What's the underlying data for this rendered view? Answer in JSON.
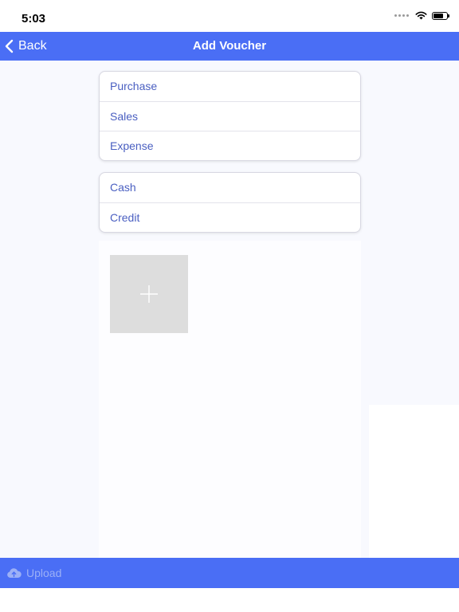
{
  "status_bar": {
    "time": "5:03"
  },
  "nav": {
    "back_label": "Back",
    "title": "Add Voucher"
  },
  "voucher_types": {
    "items": [
      "Purchase",
      "Sales",
      "Expense"
    ]
  },
  "payment_modes": {
    "items": [
      "Cash",
      "Credit"
    ]
  },
  "bottom": {
    "upload_label": "Upload"
  },
  "colors": {
    "accent": "#4a6ef5",
    "link_text": "#4a5fc1",
    "placeholder_tile": "#dddddd",
    "upload_disabled": "#9cb0f6"
  },
  "icons": {
    "back": "chevron-left-icon",
    "add": "plus-icon",
    "upload": "cloud-upload-icon",
    "wifi": "wifi-icon",
    "battery": "battery-icon"
  }
}
